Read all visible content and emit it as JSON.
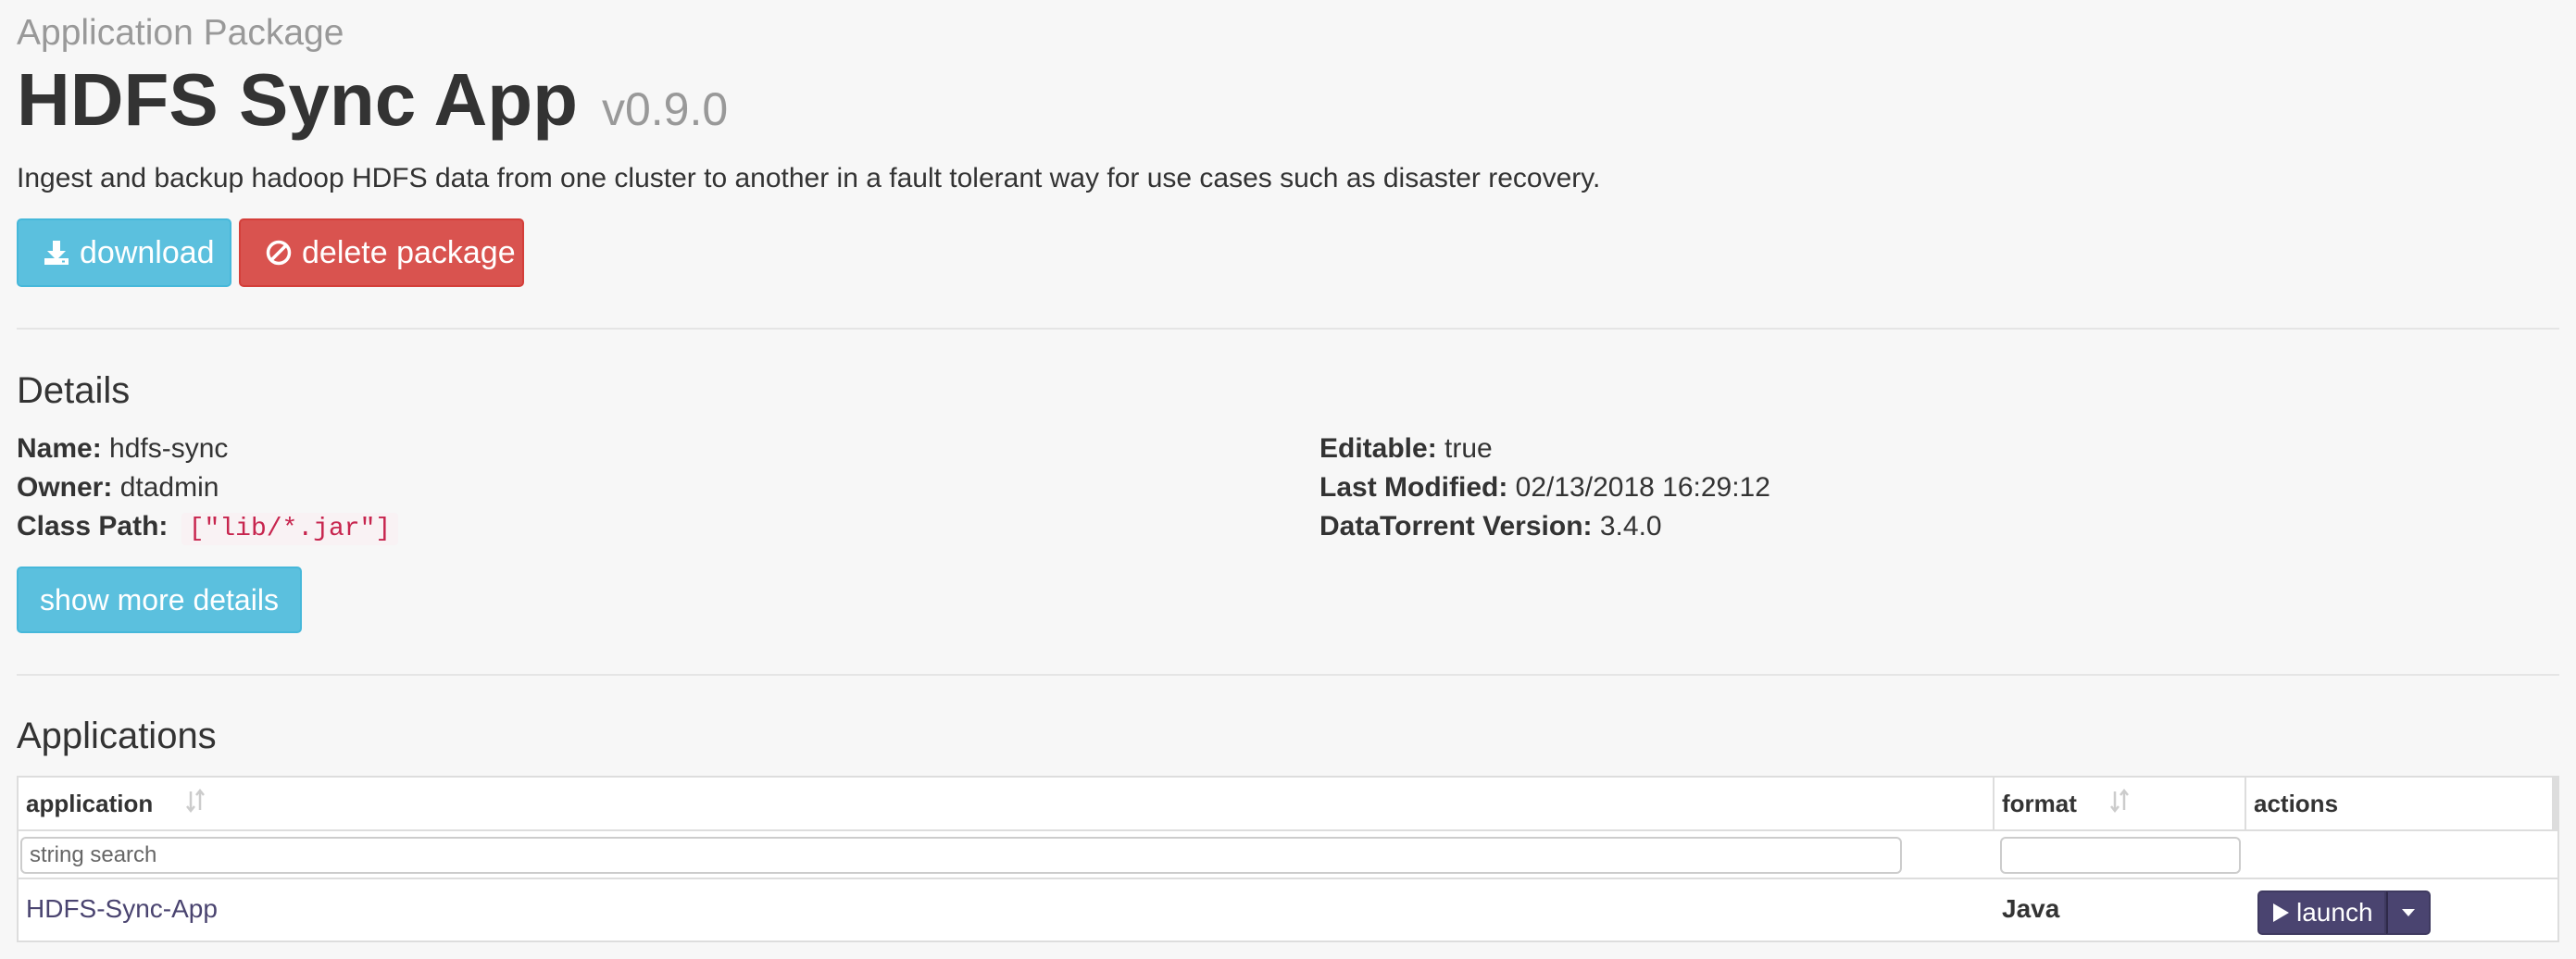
{
  "header": {
    "eyebrow": "Application Package",
    "title": "HDFS Sync App",
    "version": "v0.9.0",
    "description": "Ingest and backup hadoop HDFS data from one cluster to another in a fault tolerant way for use cases such as disaster recovery."
  },
  "actions": {
    "download_label": "download",
    "delete_label": "delete package"
  },
  "details": {
    "heading": "Details",
    "name_label": "Name:",
    "name_value": "hdfs-sync",
    "owner_label": "Owner:",
    "owner_value": "dtadmin",
    "classpath_label": "Class Path:",
    "classpath_value": "[\"lib/*.jar\"]",
    "editable_label": "Editable:",
    "editable_value": "true",
    "modified_label": "Last Modified:",
    "modified_value": "02/13/2018 16:29:12",
    "dt_version_label": "DataTorrent Version:",
    "dt_version_value": "3.4.0",
    "more_label": "show more details"
  },
  "applications": {
    "heading": "Applications",
    "columns": {
      "application": "application",
      "format": "format",
      "actions": "actions"
    },
    "filters": {
      "application_placeholder": "string search",
      "format_value": ""
    },
    "rows": [
      {
        "application": "HDFS-Sync-App",
        "format": "Java",
        "action_label": "launch"
      }
    ]
  },
  "colors": {
    "info": "#5bc0de",
    "danger": "#d9534f",
    "launch": "#4a4470"
  }
}
